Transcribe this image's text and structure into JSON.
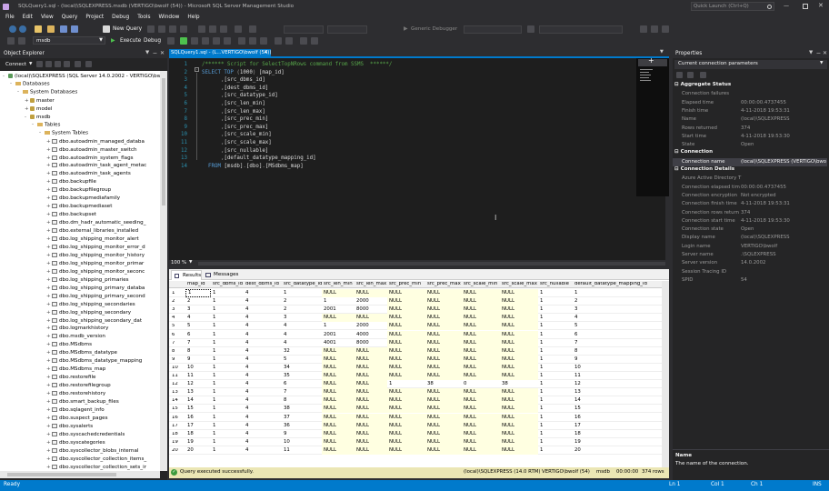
{
  "window": {
    "title": "SQLQuery1.sql - (local)\\SQLEXPRESS.msdb (VERTIGO\\bwolf (54)) - Microsoft SQL Server Management Studio",
    "quick_launch": "Quick Launch (Ctrl+Q)"
  },
  "menu": [
    "File",
    "Edit",
    "View",
    "Query",
    "Project",
    "Debug",
    "Tools",
    "Window",
    "Help"
  ],
  "toolbar": {
    "new_query": "New Query",
    "generic_debugger": "Generic Debugger",
    "database": "msdb",
    "execute": "Execute",
    "debug": "Debug"
  },
  "object_explorer": {
    "title": "Object Explorer",
    "connect": "Connect",
    "nodes": [
      {
        "label": "(local)\\SQLEXPRESS (SQL Server 14.0.2002 - VERTIGO\\bwolf)",
        "indent": 0,
        "icon": "server",
        "exp": "-"
      },
      {
        "label": "Databases",
        "indent": 1,
        "icon": "folder",
        "exp": "-"
      },
      {
        "label": "System Databases",
        "indent": 2,
        "icon": "folder",
        "exp": "-"
      },
      {
        "label": "master",
        "indent": 3,
        "icon": "db",
        "exp": "+"
      },
      {
        "label": "model",
        "indent": 3,
        "icon": "db",
        "exp": "+"
      },
      {
        "label": "msdb",
        "indent": 3,
        "icon": "db",
        "exp": "-"
      },
      {
        "label": "Tables",
        "indent": 4,
        "icon": "folder",
        "exp": "-"
      },
      {
        "label": "System Tables",
        "indent": 5,
        "icon": "folder",
        "exp": "-"
      },
      {
        "label": "dbo.autoadmin_managed_databa",
        "indent": 6,
        "icon": "table",
        "exp": "+"
      },
      {
        "label": "dbo.autoadmin_master_switch",
        "indent": 6,
        "icon": "table",
        "exp": "+"
      },
      {
        "label": "dbo.autoadmin_system_flags",
        "indent": 6,
        "icon": "table",
        "exp": "+"
      },
      {
        "label": "dbo.autoadmin_task_agent_metac",
        "indent": 6,
        "icon": "table",
        "exp": "+"
      },
      {
        "label": "dbo.autoadmin_task_agents",
        "indent": 6,
        "icon": "table",
        "exp": "+"
      },
      {
        "label": "dbo.backupfile",
        "indent": 6,
        "icon": "table",
        "exp": "+"
      },
      {
        "label": "dbo.backupfilegroup",
        "indent": 6,
        "icon": "table",
        "exp": "+"
      },
      {
        "label": "dbo.backupmediafamily",
        "indent": 6,
        "icon": "table",
        "exp": "+"
      },
      {
        "label": "dbo.backupmediaset",
        "indent": 6,
        "icon": "table",
        "exp": "+"
      },
      {
        "label": "dbo.backupset",
        "indent": 6,
        "icon": "table",
        "exp": "+"
      },
      {
        "label": "dbo.dm_hadr_automatic_seeding_",
        "indent": 6,
        "icon": "table",
        "exp": "+"
      },
      {
        "label": "dbo.external_libraries_installed",
        "indent": 6,
        "icon": "table",
        "exp": "+"
      },
      {
        "label": "dbo.log_shipping_monitor_alert",
        "indent": 6,
        "icon": "table",
        "exp": "+"
      },
      {
        "label": "dbo.log_shipping_monitor_error_d",
        "indent": 6,
        "icon": "table",
        "exp": "+"
      },
      {
        "label": "dbo.log_shipping_monitor_history",
        "indent": 6,
        "icon": "table",
        "exp": "+"
      },
      {
        "label": "dbo.log_shipping_monitor_primar",
        "indent": 6,
        "icon": "table",
        "exp": "+"
      },
      {
        "label": "dbo.log_shipping_monitor_seconc",
        "indent": 6,
        "icon": "table",
        "exp": "+"
      },
      {
        "label": "dbo.log_shipping_primaries",
        "indent": 6,
        "icon": "table",
        "exp": "+"
      },
      {
        "label": "dbo.log_shipping_primary_databa",
        "indent": 6,
        "icon": "table",
        "exp": "+"
      },
      {
        "label": "dbo.log_shipping_primary_second",
        "indent": 6,
        "icon": "table",
        "exp": "+"
      },
      {
        "label": "dbo.log_shipping_secondaries",
        "indent": 6,
        "icon": "table",
        "exp": "+"
      },
      {
        "label": "dbo.log_shipping_secondary",
        "indent": 6,
        "icon": "table",
        "exp": "+"
      },
      {
        "label": "dbo.log_shipping_secondary_dat",
        "indent": 6,
        "icon": "table",
        "exp": "+"
      },
      {
        "label": "dbo.logmarkhistory",
        "indent": 6,
        "icon": "table",
        "exp": "+"
      },
      {
        "label": "dbo.msdb_version",
        "indent": 6,
        "icon": "table",
        "exp": "+"
      },
      {
        "label": "dbo.MSdbms",
        "indent": 6,
        "icon": "table",
        "exp": "+"
      },
      {
        "label": "dbo.MSdbms_datatype",
        "indent": 6,
        "icon": "table",
        "exp": "+"
      },
      {
        "label": "dbo.MSdbms_datatype_mapping",
        "indent": 6,
        "icon": "table",
        "exp": "+"
      },
      {
        "label": "dbo.MSdbms_map",
        "indent": 6,
        "icon": "table",
        "exp": "+"
      },
      {
        "label": "dbo.restorefile",
        "indent": 6,
        "icon": "table",
        "exp": "+"
      },
      {
        "label": "dbo.restorefilegroup",
        "indent": 6,
        "icon": "table",
        "exp": "+"
      },
      {
        "label": "dbo.restorehistory",
        "indent": 6,
        "icon": "table",
        "exp": "+"
      },
      {
        "label": "dbo.smart_backup_files",
        "indent": 6,
        "icon": "table",
        "exp": "+"
      },
      {
        "label": "dbo.sqlagent_info",
        "indent": 6,
        "icon": "table",
        "exp": "+"
      },
      {
        "label": "dbo.suspect_pages",
        "indent": 6,
        "icon": "table",
        "exp": "+"
      },
      {
        "label": "dbo.sysalerts",
        "indent": 6,
        "icon": "table",
        "exp": "+"
      },
      {
        "label": "dbo.syscachedcredentials",
        "indent": 6,
        "icon": "table",
        "exp": "+"
      },
      {
        "label": "dbo.syscategories",
        "indent": 6,
        "icon": "table",
        "exp": "+"
      },
      {
        "label": "dbo.syscollector_blobs_internal",
        "indent": 6,
        "icon": "table",
        "exp": "+"
      },
      {
        "label": "dbo.syscollector_collection_items_",
        "indent": 6,
        "icon": "table",
        "exp": "+"
      },
      {
        "label": "dbo.syscollector_collection_sets_ir",
        "indent": 6,
        "icon": "table",
        "exp": "+"
      }
    ]
  },
  "tab": {
    "label": "SQLQuery1.sql - (L...VERTIGO\\bwolf (54))",
    "close": "×"
  },
  "editor": {
    "zoom": "100 %",
    "lines": [
      {
        "n": "1",
        "parts": [
          {
            "c": "cm",
            "t": "/****** Script for SelectTopNRows command from SSMS  ******/"
          }
        ]
      },
      {
        "n": "2",
        "parts": [
          {
            "c": "kw",
            "t": "SELECT TOP "
          },
          {
            "c": "gr",
            "t": "("
          },
          {
            "c": "id",
            "t": "1000"
          },
          {
            "c": "gr",
            "t": ") "
          },
          {
            "c": "id",
            "t": "[map_id]"
          }
        ]
      },
      {
        "n": "3",
        "parts": [
          {
            "c": "gr",
            "t": "      ,"
          },
          {
            "c": "id",
            "t": "[src_dbms_id]"
          }
        ]
      },
      {
        "n": "4",
        "parts": [
          {
            "c": "gr",
            "t": "      ,"
          },
          {
            "c": "id",
            "t": "[dest_dbms_id]"
          }
        ]
      },
      {
        "n": "5",
        "parts": [
          {
            "c": "gr",
            "t": "      ,"
          },
          {
            "c": "id",
            "t": "[src_datatype_id]"
          }
        ]
      },
      {
        "n": "6",
        "parts": [
          {
            "c": "gr",
            "t": "      ,"
          },
          {
            "c": "id",
            "t": "[src_len_min]"
          }
        ]
      },
      {
        "n": "7",
        "parts": [
          {
            "c": "gr",
            "t": "      ,"
          },
          {
            "c": "id",
            "t": "[src_len_max]"
          }
        ]
      },
      {
        "n": "8",
        "parts": [
          {
            "c": "gr",
            "t": "      ,"
          },
          {
            "c": "id",
            "t": "[src_prec_min]"
          }
        ]
      },
      {
        "n": "9",
        "parts": [
          {
            "c": "gr",
            "t": "      ,"
          },
          {
            "c": "id",
            "t": "[src_prec_max]"
          }
        ]
      },
      {
        "n": "10",
        "parts": [
          {
            "c": "gr",
            "t": "      ,"
          },
          {
            "c": "id",
            "t": "[src_scale_min]"
          }
        ]
      },
      {
        "n": "11",
        "parts": [
          {
            "c": "gr",
            "t": "      ,"
          },
          {
            "c": "id",
            "t": "[src_scale_max]"
          }
        ]
      },
      {
        "n": "12",
        "parts": [
          {
            "c": "gr",
            "t": "      ,"
          },
          {
            "c": "id",
            "t": "[src_nullable]"
          }
        ]
      },
      {
        "n": "13",
        "parts": [
          {
            "c": "gr",
            "t": "      ,"
          },
          {
            "c": "id",
            "t": "[default_datatype_mapping_id]"
          }
        ]
      },
      {
        "n": "14",
        "parts": [
          {
            "c": "kw",
            "t": "  FROM "
          },
          {
            "c": "id",
            "t": "[msdb]"
          },
          {
            "c": "gr",
            "t": "."
          },
          {
            "c": "id",
            "t": "[dbo]"
          },
          {
            "c": "gr",
            "t": "."
          },
          {
            "c": "id",
            "t": "[MSdbms_map]"
          }
        ]
      }
    ]
  },
  "results": {
    "tabs": [
      "Results",
      "Messages"
    ],
    "columns": [
      "map_id",
      "src_dbms_id",
      "dest_dbms_id",
      "src_datatype_id",
      "src_len_min",
      "src_len_max",
      "src_prec_min",
      "src_prec_max",
      "src_scale_min",
      "src_scale_max",
      "src_nullable",
      "default_datatype_mapping_id"
    ],
    "rows": [
      [
        "1",
        "1",
        "4",
        "1",
        "NULL",
        "NULL",
        "NULL",
        "NULL",
        "NULL",
        "NULL",
        "1",
        "1"
      ],
      [
        "2",
        "1",
        "4",
        "2",
        "1",
        "2000",
        "NULL",
        "NULL",
        "NULL",
        "NULL",
        "1",
        "2"
      ],
      [
        "3",
        "1",
        "4",
        "2",
        "2001",
        "8000",
        "NULL",
        "NULL",
        "NULL",
        "NULL",
        "1",
        "3"
      ],
      [
        "4",
        "1",
        "4",
        "3",
        "NULL",
        "NULL",
        "NULL",
        "NULL",
        "NULL",
        "NULL",
        "1",
        "4"
      ],
      [
        "5",
        "1",
        "4",
        "4",
        "1",
        "2000",
        "NULL",
        "NULL",
        "NULL",
        "NULL",
        "1",
        "5"
      ],
      [
        "6",
        "1",
        "4",
        "4",
        "2001",
        "4000",
        "NULL",
        "NULL",
        "NULL",
        "NULL",
        "1",
        "6"
      ],
      [
        "7",
        "1",
        "4",
        "4",
        "4001",
        "8000",
        "NULL",
        "NULL",
        "NULL",
        "NULL",
        "1",
        "7"
      ],
      [
        "8",
        "1",
        "4",
        "32",
        "NULL",
        "NULL",
        "NULL",
        "NULL",
        "NULL",
        "NULL",
        "1",
        "8"
      ],
      [
        "9",
        "1",
        "4",
        "5",
        "NULL",
        "NULL",
        "NULL",
        "NULL",
        "NULL",
        "NULL",
        "1",
        "9"
      ],
      [
        "10",
        "1",
        "4",
        "34",
        "NULL",
        "NULL",
        "NULL",
        "NULL",
        "NULL",
        "NULL",
        "1",
        "10"
      ],
      [
        "11",
        "1",
        "4",
        "35",
        "NULL",
        "NULL",
        "NULL",
        "NULL",
        "NULL",
        "NULL",
        "1",
        "11"
      ],
      [
        "12",
        "1",
        "4",
        "6",
        "NULL",
        "NULL",
        "1",
        "38",
        "0",
        "38",
        "1",
        "12"
      ],
      [
        "13",
        "1",
        "4",
        "7",
        "NULL",
        "NULL",
        "NULL",
        "NULL",
        "NULL",
        "NULL",
        "1",
        "13"
      ],
      [
        "14",
        "1",
        "4",
        "8",
        "NULL",
        "NULL",
        "NULL",
        "NULL",
        "NULL",
        "NULL",
        "1",
        "14"
      ],
      [
        "15",
        "1",
        "4",
        "38",
        "NULL",
        "NULL",
        "NULL",
        "NULL",
        "NULL",
        "NULL",
        "1",
        "15"
      ],
      [
        "16",
        "1",
        "4",
        "37",
        "NULL",
        "NULL",
        "NULL",
        "NULL",
        "NULL",
        "NULL",
        "1",
        "16"
      ],
      [
        "17",
        "1",
        "4",
        "36",
        "NULL",
        "NULL",
        "NULL",
        "NULL",
        "NULL",
        "NULL",
        "1",
        "17"
      ],
      [
        "18",
        "1",
        "4",
        "9",
        "NULL",
        "NULL",
        "NULL",
        "NULL",
        "NULL",
        "NULL",
        "1",
        "18"
      ],
      [
        "19",
        "1",
        "4",
        "10",
        "NULL",
        "NULL",
        "NULL",
        "NULL",
        "NULL",
        "NULL",
        "1",
        "19"
      ],
      [
        "20",
        "1",
        "4",
        "11",
        "NULL",
        "NULL",
        "NULL",
        "NULL",
        "NULL",
        "NULL",
        "1",
        "20"
      ]
    ]
  },
  "query_status": {
    "message": "Query executed successfully.",
    "server": "(local)\\SQLEXPRESS (14.0 RTM)",
    "user": "VERTIGO\\bwolf (54)",
    "db": "msdb",
    "time": "00:00:00",
    "rows": "374 rows"
  },
  "properties": {
    "title": "Properties",
    "object": "Current connection parameters",
    "sections": [
      {
        "name": "Aggregate Status",
        "rows": [
          [
            "Connection failures",
            ""
          ],
          [
            "Elapsed time",
            "00:00:00.4737455"
          ],
          [
            "Finish time",
            "4-11-2018 19:53:31"
          ],
          [
            "Name",
            "(local)\\SQLEXPRESS"
          ],
          [
            "Rows returned",
            "374"
          ],
          [
            "Start time",
            "4-11-2018 19:53:30"
          ],
          [
            "State",
            "Open"
          ]
        ]
      },
      {
        "name": "Connection",
        "rows": [
          [
            "Connection name",
            "(local)\\SQLEXPRESS (VERTIGO\\bwolf"
          ]
        ]
      },
      {
        "name": "Connection Details",
        "rows": [
          [
            "Azure Active Directory T",
            ""
          ],
          [
            "Connection elapsed tim",
            "00:00:00.4737455"
          ],
          [
            "Connection encryption",
            "Not encrypted"
          ],
          [
            "Connection finish time",
            "4-11-2018 19:53:31"
          ],
          [
            "Connection rows return",
            "374"
          ],
          [
            "Connection start time",
            "4-11-2018 19:53:30"
          ],
          [
            "Connection state",
            "Open"
          ],
          [
            "Display name",
            "(local)\\SQLEXPRESS"
          ],
          [
            "Login name",
            "VERTIGO\\bwolf"
          ],
          [
            "Server name",
            ".\\SQLEXPRESS"
          ],
          [
            "Server version",
            "14.0.2002"
          ],
          [
            "Session Tracing ID",
            ""
          ],
          [
            "SPID",
            "54"
          ]
        ]
      }
    ],
    "desc_title": "Name",
    "desc_text": "The name of the connection."
  },
  "statusbar": {
    "left": "Ready",
    "ln": "Ln 1",
    "col": "Col 1",
    "ch": "Ch 1",
    "ins": "INS"
  },
  "colors": {
    "accent": "#007acc",
    "editor_bg": "#1e1e1e",
    "panel_bg": "#252526"
  }
}
